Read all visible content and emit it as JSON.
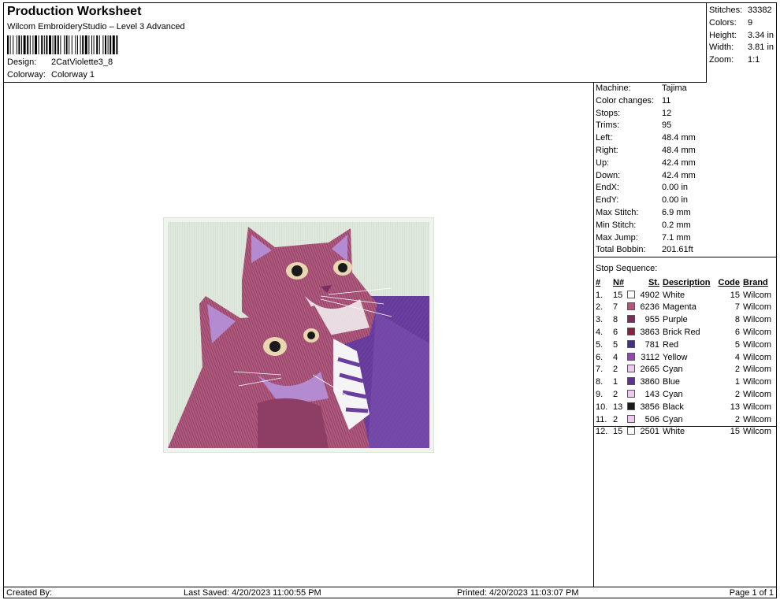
{
  "header": {
    "title": "Production Worksheet",
    "subtitle": "Wilcom EmbroideryStudio – Level 3 Advanced",
    "design_label": "Design:",
    "design_value": "2CatViolette3_8",
    "colorway_label": "Colorway:",
    "colorway_value": "Colorway 1"
  },
  "summary": [
    {
      "label": "Stitches:",
      "value": "33382"
    },
    {
      "label": "Colors:",
      "value": "9"
    },
    {
      "label": "Height:",
      "value": "3.34 in"
    },
    {
      "label": "Width:",
      "value": "3.81 in"
    },
    {
      "label": "Zoom:",
      "value": "1:1"
    }
  ],
  "machine_info": [
    {
      "label": "Machine:",
      "value": "Tajima"
    },
    {
      "label": "Color changes:",
      "value": "11"
    },
    {
      "label": "Stops:",
      "value": "12"
    },
    {
      "label": "Trims:",
      "value": "95"
    },
    {
      "label": "Left:",
      "value": "48.4 mm"
    },
    {
      "label": "Right:",
      "value": "48.4 mm"
    },
    {
      "label": "Up:",
      "value": "42.4 mm"
    },
    {
      "label": "Down:",
      "value": "42.4 mm"
    },
    {
      "label": "EndX:",
      "value": "0.00 in"
    },
    {
      "label": "EndY:",
      "value": "0.00 in"
    },
    {
      "label": "Max Stitch:",
      "value": "6.9 mm"
    },
    {
      "label": "Min Stitch:",
      "value": "0.2 mm"
    },
    {
      "label": "Max Jump:",
      "value": "7.1 mm"
    },
    {
      "label": "Total Bobbin:",
      "value": "201.61ft"
    }
  ],
  "stop_sequence": {
    "title": "Stop Sequence:",
    "columns": [
      "#",
      "N#",
      "St.",
      "Description",
      "Code",
      "Brand"
    ],
    "rows": [
      {
        "idx": "1.",
        "n": "15",
        "color": "#ffffff",
        "st": "4902",
        "desc": "White",
        "code": "15",
        "brand": "Wilcom"
      },
      {
        "idx": "2.",
        "n": "7",
        "color": "#b8527e",
        "st": "6236",
        "desc": "Magenta",
        "code": "7",
        "brand": "Wilcom"
      },
      {
        "idx": "3.",
        "n": "8",
        "color": "#7a2e5e",
        "st": "955",
        "desc": "Purple",
        "code": "8",
        "brand": "Wilcom"
      },
      {
        "idx": "4.",
        "n": "6",
        "color": "#8a1f3e",
        "st": "3863",
        "desc": "Brick Red",
        "code": "6",
        "brand": "Wilcom"
      },
      {
        "idx": "5.",
        "n": "5",
        "color": "#4a2d8a",
        "st": "781",
        "desc": "Red",
        "code": "5",
        "brand": "Wilcom"
      },
      {
        "idx": "6.",
        "n": "4",
        "color": "#9546b5",
        "st": "3112",
        "desc": "Yellow",
        "code": "4",
        "brand": "Wilcom"
      },
      {
        "idx": "7.",
        "n": "2",
        "color": "#efc8ef",
        "st": "2665",
        "desc": "Cyan",
        "code": "2",
        "brand": "Wilcom"
      },
      {
        "idx": "8.",
        "n": "1",
        "color": "#5a3494",
        "st": "3860",
        "desc": "Blue",
        "code": "1",
        "brand": "Wilcom"
      },
      {
        "idx": "9.",
        "n": "2",
        "color": "#efc8ef",
        "st": "143",
        "desc": "Cyan",
        "code": "2",
        "brand": "Wilcom"
      },
      {
        "idx": "10.",
        "n": "13",
        "color": "#1a1a1a",
        "st": "3856",
        "desc": "Black",
        "code": "13",
        "brand": "Wilcom"
      },
      {
        "idx": "11.",
        "n": "2",
        "color": "#efc8ef",
        "st": "506",
        "desc": "Cyan",
        "code": "2",
        "brand": "Wilcom"
      },
      {
        "idx": "12.",
        "n": "15",
        "color": "#ffffff",
        "st": "2501",
        "desc": "White",
        "code": "15",
        "brand": "Wilcom"
      }
    ]
  },
  "footer": {
    "created_by": "Created By:",
    "last_saved": "Last Saved: 4/20/2023 11:00:55 PM",
    "printed": "Printed: 4/20/2023 11:03:07 PM",
    "page": "Page 1 of 1"
  },
  "design_colors": {
    "background": "#dfe8dc",
    "border": "#f0f4ee",
    "fur": "#b05a7e",
    "fur_dark": "#7a2e5e",
    "purple": "#6a3e9e",
    "lilac": "#b48ad0",
    "white": "#f4f4f4",
    "black": "#1a1a1a"
  }
}
